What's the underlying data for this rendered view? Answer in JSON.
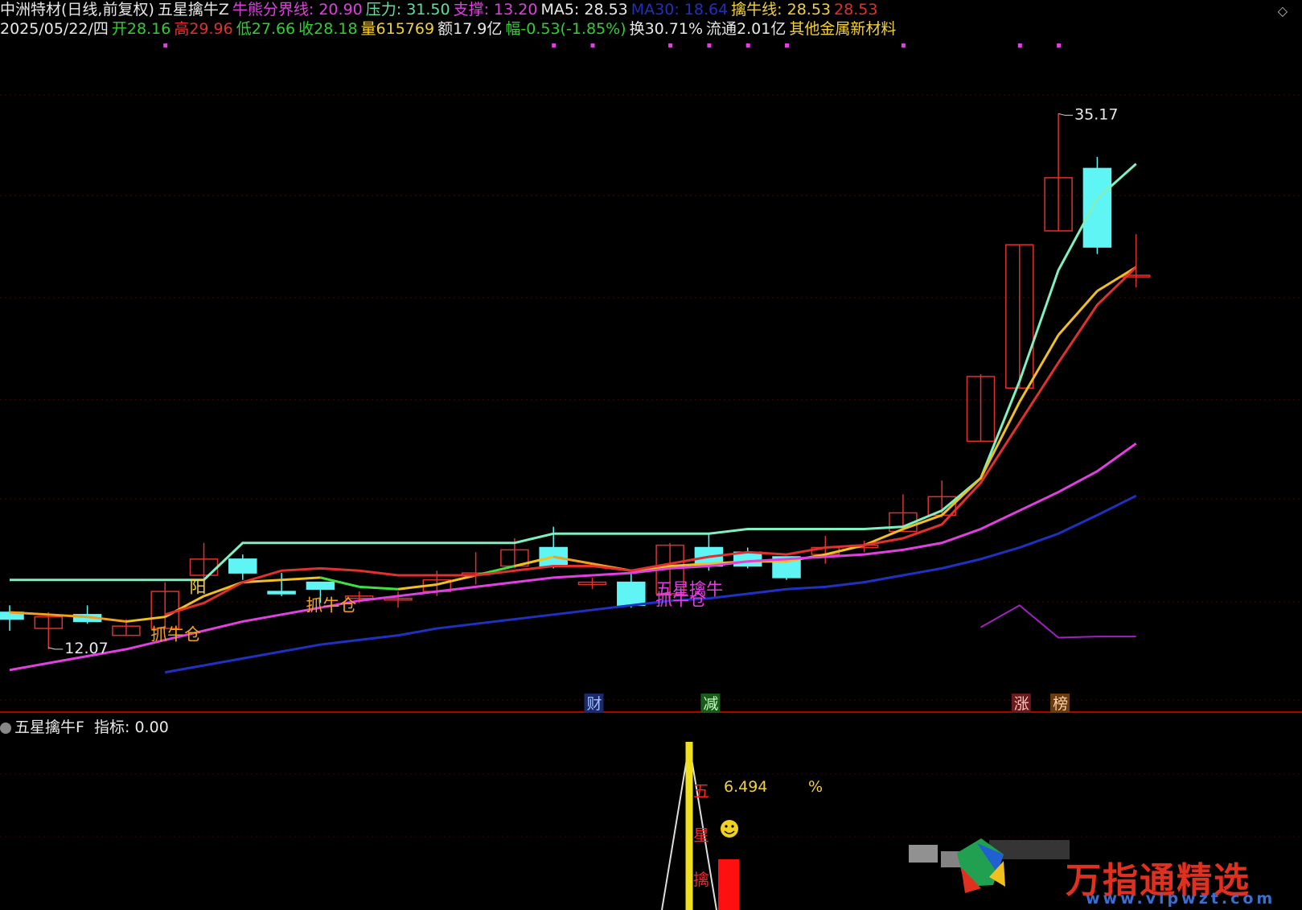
{
  "header": {
    "row1": [
      {
        "text": "中洲特材(日线,前复权)",
        "color": "#e8e8e8"
      },
      {
        "text": "五星擒牛Z",
        "color": "#e8e8e8"
      },
      {
        "text": "牛熊分界线: 20.90",
        "color": "#e040e0"
      },
      {
        "text": "压力: 31.50",
        "color": "#5fe0a0"
      },
      {
        "text": "支撑: 13.20",
        "color": "#e040e0"
      },
      {
        "text": "MA5: 28.53",
        "color": "#e8e8e8"
      },
      {
        "text": "MA30: 18.64",
        "color": "#2030c0"
      },
      {
        "text": "擒牛线: 28.53",
        "color": "#f0d040"
      },
      {
        "text": "28.53",
        "color": "#e03030"
      }
    ],
    "row2": [
      {
        "text": "2025/05/22/四",
        "color": "#e8e8e8"
      },
      {
        "text": "开28.16",
        "color": "#30d030"
      },
      {
        "text": "高29.96",
        "color": "#e03030"
      },
      {
        "text": "低27.66",
        "color": "#30d030"
      },
      {
        "text": "收28.18",
        "color": "#30d030"
      },
      {
        "text": "量615769",
        "color": "#f0d040"
      },
      {
        "text": "额17.9亿",
        "color": "#e8e8e8"
      },
      {
        "text": "幅-0.53(-1.85%)",
        "color": "#30d030"
      },
      {
        "text": "换30.71%",
        "color": "#e8e8e8"
      },
      {
        "text": "流通2.01亿",
        "color": "#e8e8e8"
      },
      {
        "text": "其他金属新材料",
        "color": "#f0d040"
      }
    ]
  },
  "top_right_icon": "diamond-icon",
  "chart_data": {
    "type": "candlestick",
    "y_range": [
      10.5,
      38.0
    ],
    "candles": [
      {
        "o": 13.6,
        "c": 13.3,
        "h": 13.9,
        "l": 12.8
      },
      {
        "o": 12.9,
        "c": 13.4,
        "h": 13.6,
        "l": 12.0
      },
      {
        "o": 13.5,
        "c": 13.2,
        "h": 13.9,
        "l": 13.1
      },
      {
        "o": 12.6,
        "c": 13.0,
        "h": 13.3,
        "l": 12.6
      },
      {
        "o": 12.9,
        "c": 14.5,
        "h": 14.9,
        "l": 12.9
      },
      {
        "o": 15.2,
        "c": 15.9,
        "h": 16.6,
        "l": 14.8
      },
      {
        "o": 15.9,
        "c": 15.3,
        "h": 16.1,
        "l": 15.0
      },
      {
        "o": 14.5,
        "c": 14.4,
        "h": 15.3,
        "l": 14.3
      },
      {
        "o": 14.9,
        "c": 14.6,
        "h": 14.9,
        "l": 14.0
      },
      {
        "o": 14.2,
        "c": 14.3,
        "h": 14.5,
        "l": 14.0
      },
      {
        "o": 14.2,
        "c": 14.2,
        "h": 14.5,
        "l": 13.8
      },
      {
        "o": 14.5,
        "c": 15.0,
        "h": 15.4,
        "l": 14.3
      },
      {
        "o": 15.3,
        "c": 15.3,
        "h": 16.2,
        "l": 14.8
      },
      {
        "o": 15.6,
        "c": 16.3,
        "h": 16.8,
        "l": 15.5
      },
      {
        "o": 16.4,
        "c": 15.6,
        "h": 17.3,
        "l": 15.5
      },
      {
        "o": 14.8,
        "c": 14.9,
        "h": 15.1,
        "l": 14.6
      },
      {
        "o": 14.9,
        "c": 13.9,
        "h": 15.3,
        "l": 13.8
      },
      {
        "o": 14.4,
        "c": 16.5,
        "h": 16.6,
        "l": 13.9
      },
      {
        "o": 16.4,
        "c": 15.6,
        "h": 17.0,
        "l": 15.4
      },
      {
        "o": 16.2,
        "c": 15.6,
        "h": 16.4,
        "l": 15.5
      },
      {
        "o": 16.0,
        "c": 15.1,
        "h": 16.0,
        "l": 15.0
      },
      {
        "o": 16.1,
        "c": 16.4,
        "h": 16.9,
        "l": 15.7
      },
      {
        "o": 16.4,
        "c": 16.5,
        "h": 16.7,
        "l": 16.2
      },
      {
        "o": 17.1,
        "c": 17.9,
        "h": 18.7,
        "l": 17.1
      },
      {
        "o": 17.8,
        "c": 18.6,
        "h": 19.3,
        "l": 17.7
      },
      {
        "o": 21.0,
        "c": 23.8,
        "h": 23.9,
        "l": 21.0
      },
      {
        "o": 23.3,
        "c": 29.5,
        "h": 29.5,
        "l": 23.3
      },
      {
        "o": 30.1,
        "c": 32.4,
        "h": 35.17,
        "l": 30.1
      },
      {
        "o": 32.8,
        "c": 29.4,
        "h": 33.3,
        "l": 29.1
      },
      {
        "o": 28.16,
        "c": 28.18,
        "h": 29.96,
        "l": 27.66
      }
    ],
    "candle_colors": {
      "up": "#e03030",
      "down": "#5ff5f5"
    },
    "lines": [
      {
        "color": "pressure-line",
        "values": [
          15.0,
          15.0,
          15.0,
          15.0,
          15.0,
          15.0,
          16.6,
          16.6,
          16.6,
          16.6,
          16.6,
          16.6,
          16.6,
          16.6,
          17.0,
          17.0,
          17.0,
          17.0,
          17.0,
          17.2,
          17.2,
          17.2,
          17.2,
          17.3,
          18.0,
          19.4,
          23.6,
          28.4,
          31.5,
          33.0
        ]
      },
      {
        "color": "#f0a020",
        "values": [
          13.6,
          13.5,
          13.4,
          13.2,
          13.4,
          14.3,
          14.9,
          15.0,
          15.1,
          14.7,
          14.6,
          14.8,
          15.2,
          15.6,
          16.0,
          15.7,
          15.4,
          15.6,
          15.7,
          15.8,
          15.8,
          16.1,
          16.5,
          17.2,
          17.8,
          19.4,
          22.7,
          25.6,
          27.5,
          28.53
        ]
      },
      {
        "color": "#e03030",
        "values": [
          null,
          null,
          null,
          null,
          13.5,
          14.0,
          14.9,
          15.4,
          15.5,
          15.4,
          15.2,
          15.2,
          15.2,
          15.4,
          15.6,
          15.6,
          15.4,
          15.7,
          16.0,
          16.2,
          16.1,
          16.4,
          16.5,
          16.8,
          17.4,
          19.2,
          21.8,
          24.4,
          26.9,
          28.53
        ]
      },
      {
        "color": "#e040e0",
        "values": [
          11.1,
          11.4,
          11.7,
          12.0,
          12.4,
          12.8,
          13.2,
          13.5,
          13.8,
          14.1,
          14.3,
          14.5,
          14.7,
          14.9,
          15.1,
          15.2,
          15.3,
          15.5,
          15.6,
          15.8,
          15.9,
          16.0,
          16.1,
          16.3,
          16.6,
          17.2,
          18.0,
          18.8,
          19.7,
          20.9
        ]
      },
      {
        "color": "#2030c0",
        "values": [
          null,
          null,
          null,
          null,
          11.0,
          11.3,
          11.6,
          11.9,
          12.2,
          12.4,
          12.6,
          12.9,
          13.1,
          13.3,
          13.5,
          13.7,
          13.9,
          14.1,
          14.2,
          14.4,
          14.6,
          14.7,
          14.9,
          15.2,
          15.5,
          15.9,
          16.4,
          17.0,
          17.8,
          18.64
        ]
      }
    ],
    "support_line": {
      "color": "#a020c0",
      "values": [
        12.95,
        13.9,
        12.5,
        12.55,
        12.55
      ]
    },
    "annotations": [
      {
        "text": "35.17",
        "candle": 27,
        "price": 35.17
      },
      {
        "text": "12.07",
        "candle": 1,
        "price": 12.07
      }
    ],
    "markers": [
      {
        "text": "阳",
        "candle": 5,
        "price": 14.45,
        "color": "#f0d040"
      },
      {
        "text": "抓牛仓",
        "candle": 4,
        "price": 12.4,
        "color": "#f0a020"
      },
      {
        "text": "抓牛仓",
        "candle": 8,
        "price": 13.65,
        "color": "#f0a020"
      },
      {
        "text": "五星擒牛",
        "candle": 17,
        "price": 14.35,
        "color": "#e040e0"
      },
      {
        "text": "抓牛仓",
        "candle": 17,
        "price": 13.9,
        "color": "#e040e0"
      }
    ],
    "badges": [
      {
        "text": "财",
        "candle": 15,
        "bg": "#1a2a6a",
        "color": "#9fc0ff"
      },
      {
        "text": "减",
        "candle": 18,
        "bg": "#1a5a1a",
        "color": "#c0ffc0"
      },
      {
        "text": "涨",
        "candle": 26,
        "bg": "#6a1a1a",
        "color": "#ffc0c0"
      },
      {
        "text": "榜",
        "candle": 27,
        "bg": "#6a3a10",
        "color": "#ffd0a0"
      }
    ],
    "top_dots_candles": [
      4,
      14,
      15,
      17,
      18,
      19,
      20,
      23,
      26,
      27
    ],
    "subchart": {
      "title": "五星擒牛F",
      "indicator_label": "指标: 0.00",
      "value_text": "6.494",
      "percent_text": "%",
      "vertical_label": "五星擒",
      "smile": "smile-icon"
    }
  },
  "watermark": {
    "text": "万指通精选",
    "url": "www.vipwzt.com"
  }
}
